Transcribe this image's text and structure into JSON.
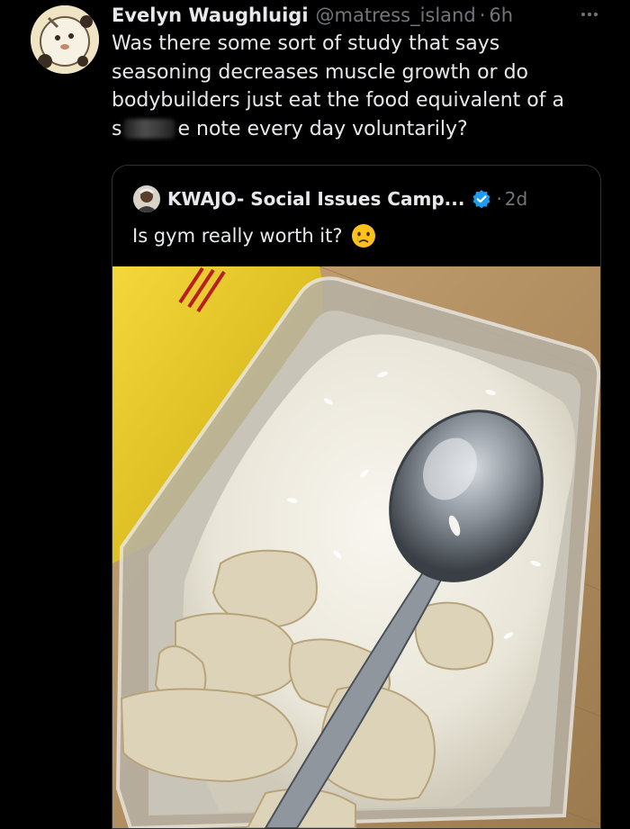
{
  "tweet": {
    "display_name": "Evelyn Waughluigi",
    "handle": "@matress_island",
    "separator": "·",
    "time": "6h",
    "text_lines": [
      "Was there some sort of study that says",
      "seasoning decreases muscle growth or do",
      "bodybuilders just eat the food equivalent of a"
    ],
    "last_line_start": "s",
    "last_line_end": "e note every day voluntarily?",
    "avatar_icon": "cartoon-avatar-icon",
    "more_icon": "more-options-icon"
  },
  "quoted_tweet": {
    "display_name": "KWAJO- Social Issues Camp...",
    "separator": "·",
    "time": "2d",
    "text": "Is gym really worth it?",
    "emoji_icon": "crying-face-emoji-icon",
    "verified_icon": "verified-badge-icon",
    "photo": "photo of plain white rice and boiled chicken in a plastic container with a metal spoon"
  },
  "colors": {
    "background": "#000000",
    "text_primary": "#e7e9ea",
    "text_secondary": "#71767b",
    "border": "#2f3336",
    "verified_blue": "#1d9bf0"
  }
}
